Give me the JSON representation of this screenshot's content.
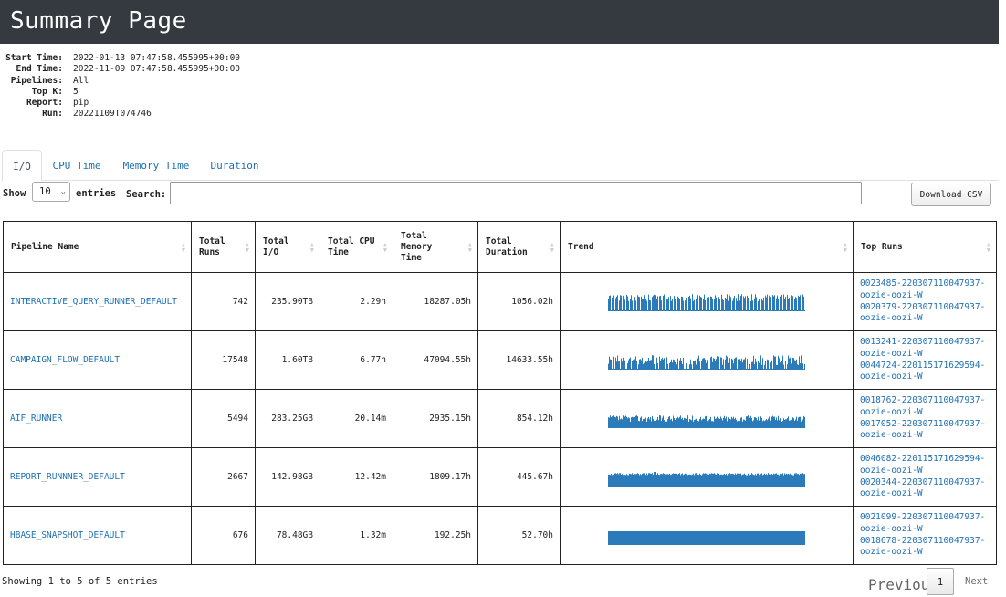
{
  "header": {
    "title": "Summary Page"
  },
  "meta": [
    {
      "key": "Start Time:",
      "value": "2022-01-13 07:47:58.455995+00:00"
    },
    {
      "key": "End Time:",
      "value": "2022-11-09 07:47:58.455995+00:00"
    },
    {
      "key": "Pipelines:",
      "value": "All"
    },
    {
      "key": "Top K:",
      "value": "5"
    },
    {
      "key": "Report:",
      "value": "pip"
    },
    {
      "key": "Run:",
      "value": "20221109T074746"
    }
  ],
  "tabs": [
    "I/O",
    "CPU Time",
    "Memory Time",
    "Duration"
  ],
  "controls": {
    "show_label": "Show",
    "page_size": "10",
    "entries_label": "entries",
    "search_label": "Search:",
    "search_value": "",
    "download_label": "Download CSV"
  },
  "table": {
    "columns": [
      "Pipeline Name",
      "Total Runs",
      "Total I/O",
      "Total CPU Time",
      "Total Memory Time",
      "Total Duration",
      "Trend",
      "Top Runs"
    ],
    "rows": [
      {
        "name": "INTERACTIVE_QUERY_RUNNER_DEFAULT",
        "runs": "742",
        "io": "235.90TB",
        "cpu": "2.29h",
        "mem": "18287.05h",
        "dur": "1056.02h",
        "top_runs": [
          "0023485-220307110047937-",
          "oozie-oozi-W",
          "0020379-220307110047937-",
          "oozie-oozi-W"
        ]
      },
      {
        "name": "CAMPAIGN_FLOW_DEFAULT",
        "runs": "17548",
        "io": "1.60TB",
        "cpu": "6.77h",
        "mem": "47094.55h",
        "dur": "14633.55h",
        "top_runs": [
          "0013241-220307110047937-",
          "oozie-oozi-W",
          "0044724-220115171629594-",
          "oozie-oozi-W"
        ]
      },
      {
        "name": "AIF_RUNNER",
        "runs": "5494",
        "io": "283.25GB",
        "cpu": "20.14m",
        "mem": "2935.15h",
        "dur": "854.12h",
        "top_runs": [
          "0018762-220307110047937-",
          "oozie-oozi-W",
          "0017052-220307110047937-",
          "oozie-oozi-W"
        ]
      },
      {
        "name": "REPORT_RUNNNER_DEFAULT",
        "runs": "2667",
        "io": "142.98GB",
        "cpu": "12.42m",
        "mem": "1809.17h",
        "dur": "445.67h",
        "top_runs": [
          "0046082-220115171629594-",
          "oozie-oozi-W",
          "0020344-220307110047937-",
          "oozie-oozi-W"
        ]
      },
      {
        "name": "HBASE_SNAPSHOT_DEFAULT",
        "runs": "676",
        "io": "78.48GB",
        "cpu": "1.32m",
        "mem": "192.25h",
        "dur": "52.70h",
        "top_runs": [
          "0021099-220307110047937-",
          "oozie-oozi-W",
          "0018678-220307110047937-",
          "oozie-oozi-W"
        ]
      }
    ]
  },
  "footer": {
    "info": "Showing 1 to 5 of 5 entries",
    "prev": "Previous",
    "page": "1",
    "next": "Next"
  },
  "colors": {
    "header_bg": "#343a40",
    "link": "#1f6fb3",
    "trend": "#2b7bba"
  }
}
